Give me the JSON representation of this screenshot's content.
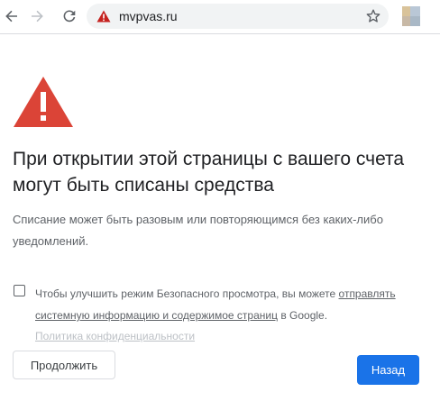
{
  "toolbar": {
    "url": "mvpvas.ru",
    "icons": {
      "back": "back-arrow-icon",
      "forward": "forward-arrow-icon",
      "reload": "reload-icon",
      "security": "not-secure-warning-icon",
      "bookmark": "star-icon",
      "extension": "extension-icon"
    }
  },
  "interstitial": {
    "heading": "При открытии этой страницы с вашего счета могут быть списаны средства",
    "description": "Списание может быть разовым или повторяющимся без каких-либо уведомлений.",
    "optin_prefix": "Чтобы улучшить режим Безопасного просмотра, вы можете ",
    "optin_link": "отправлять системную информацию и содержимое страниц",
    "optin_suffix": " в Google.",
    "optin_checked": false,
    "privacy_link": "Политика конфиденциальности",
    "continue_label": "Продолжить",
    "back_label": "Назад",
    "icon": "warning-triangle-icon"
  },
  "colors": {
    "warning_red": "#db4437",
    "primary_blue": "#1a73e8",
    "text_dark": "#202124",
    "text_muted": "#5f6368"
  }
}
